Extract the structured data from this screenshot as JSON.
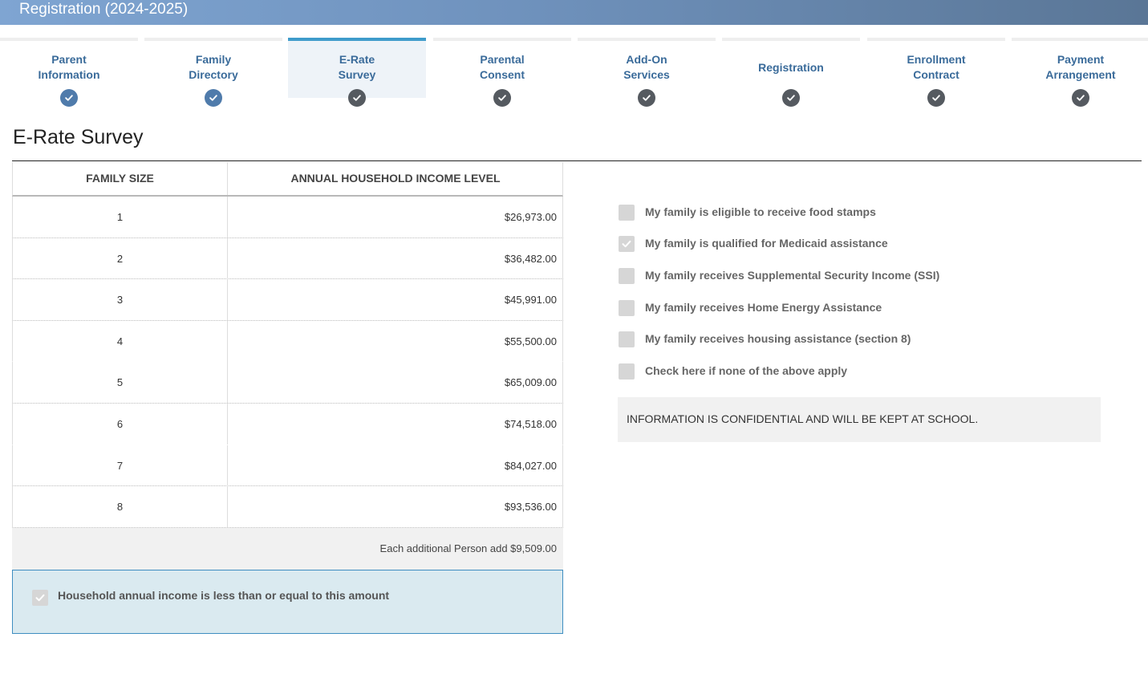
{
  "header": {
    "title": "Registration (2024-2025)"
  },
  "steps": [
    {
      "label_line1": "Parent",
      "label_line2": "Information",
      "status": "complete"
    },
    {
      "label_line1": "Family",
      "label_line2": "Directory",
      "status": "complete"
    },
    {
      "label_line1": "E-Rate",
      "label_line2": "Survey",
      "status": "current"
    },
    {
      "label_line1": "Parental",
      "label_line2": "Consent",
      "status": "pending"
    },
    {
      "label_line1": "Add-On",
      "label_line2": "Services",
      "status": "pending"
    },
    {
      "label_line1": "Registration",
      "label_line2": "",
      "status": "pending"
    },
    {
      "label_line1": "Enrollment",
      "label_line2": "Contract",
      "status": "pending"
    },
    {
      "label_line1": "Payment",
      "label_line2": "Arrangement",
      "status": "pending"
    }
  ],
  "page": {
    "title": "E-Rate Survey"
  },
  "income_table": {
    "headers": [
      "FAMILY SIZE",
      "ANNUAL HOUSEHOLD INCOME LEVEL"
    ],
    "rows": [
      {
        "size": "1",
        "income": "$26,973.00"
      },
      {
        "size": "2",
        "income": "$36,482.00"
      },
      {
        "size": "3",
        "income": "$45,991.00"
      },
      {
        "size": "4",
        "income": "$55,500.00"
      },
      {
        "size": "5",
        "income": "$65,009.00"
      },
      {
        "size": "6",
        "income": "$74,518.00"
      },
      {
        "size": "7",
        "income": "$84,027.00"
      },
      {
        "size": "8",
        "income": "$93,536.00"
      }
    ],
    "additional_note": "Each additional Person add $9,509.00",
    "household_checkbox": {
      "label": "Household annual income is less than or equal to this amount",
      "checked": true
    }
  },
  "assistance_options": [
    {
      "label": "My family is eligible to receive food stamps",
      "checked": false
    },
    {
      "label": "My family is qualified for Medicaid assistance",
      "checked": true
    },
    {
      "label": "My family receives Supplemental Security Income (SSI)",
      "checked": false
    },
    {
      "label": "My family receives Home Energy Assistance",
      "checked": false
    },
    {
      "label": "My family receives housing assistance (section 8)",
      "checked": false
    },
    {
      "label": "Check here if none of the above apply",
      "checked": false
    }
  ],
  "confidential_note": "INFORMATION IS CONFIDENTIAL AND WILL BE KEPT AT SCHOOL.",
  "colors": {
    "header_gradient_start": "#7fa5d2",
    "header_gradient_end": "#5a7696",
    "step_label": "#3a6b9a",
    "step_complete": "#4f7bab",
    "step_pending": "#555a60",
    "active_step_accent": "#3f9ccb",
    "household_box_bg": "#daeaf0",
    "household_box_border": "#3f8ec1"
  }
}
